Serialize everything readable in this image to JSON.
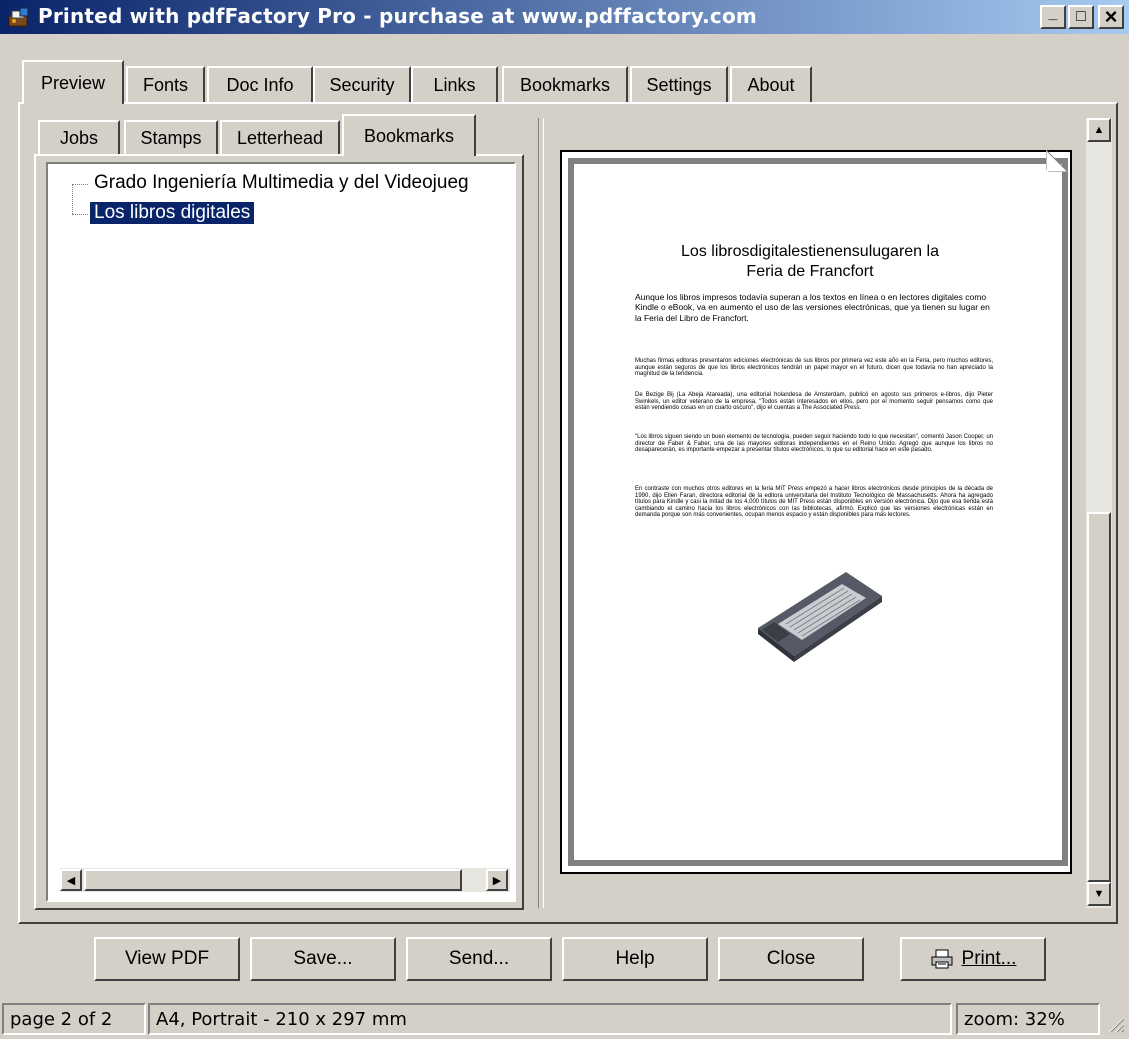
{
  "window": {
    "title": "Printed with pdfFactory Pro - purchase at www.pdffactory.com",
    "minimize": "_",
    "maximize": "□",
    "close": "×"
  },
  "tabs": [
    "Preview",
    "Fonts",
    "Doc Info",
    "Security",
    "Links",
    "Bookmarks",
    "Settings",
    "About"
  ],
  "subtabs": [
    "Jobs",
    "Stamps",
    "Letterhead",
    "Bookmarks"
  ],
  "bookmarks": [
    "Grado Ingeniería Multimedia y del Videojueg",
    "Los libros digitales"
  ],
  "document": {
    "title_line1": "Los librosdigitalestienensulugaren la",
    "title_line2": "Feria de Francfort",
    "lead": "Aunque los libros impresos todavía superan a los textos en línea o en lectores digitales como Kindle o eBook, va en aumento el uso de las versiones electrónicas, que ya tienen su lugar en la Feria del Libro de Francfort.",
    "para1": "Muchas firmas editoras presentaron ediciones electrónicas de sus libros por primera vez este año en la Feria, pero muchos editores, aunque están seguros de que los libros electrónicos tendrán un papel mayor en el futuro, dicen que todavía no han apreciado la magnitud de la tendencia.",
    "para2": "De Bezige Bij (La Abeja Atareada), una editorial holandesa de Amsterdam, publicó en agosto sus primeros e-libros, dijo Pieter Swinkels, un editor veterano de la empresa. \"Todos están interesados en ellos, pero por el momento seguir pensamos como que están vendiendo cosas en un cuarto oscuro\", dijo el cuentas a The Associated Press.",
    "para3": "\"Los libros siguen siendo un buen elemento de tecnología, pueden seguir haciendo todo lo que necesitan\", comentó Jason Cooper, un director de Faber & Faber, una de las mayores editoras independientes en el Reino Unido. Agregó que aunque los libros no desaparecerán, es importante empezar a presentar títulos electrónicos, lo que su editorial hace en este pasado.",
    "para4": "En contraste con muchos otros editores en la feria MIT Press empezó a hacer libros electrónicos desde principios de la década de 1990, dijo Ellen Faran, directora editorial de la editora universitaria del Instituto Tecnológico de Massachusetts. Ahora ha agregado títulos para Kindle y casi la mitad de los 4,000 títulos de MIT Press están disponibles en versión electrónica. Dijo que esa tienda está cambiando el camino hacia los libros electrónicos con las bibliotecas, afirmó. Explicó que las versiones electrónicas están en demanda porque son más convenientes, ocupan menos espacio y están disponibles para más lectores."
  },
  "buttons": {
    "view_pdf": "View PDF",
    "save": "Save...",
    "send": "Send...",
    "help": "Help",
    "close": "Close",
    "print": "Print..."
  },
  "status": {
    "page": "page 2 of 2",
    "paper": "A4, Portrait - 210 x 297 mm",
    "zoom": "zoom: 32%"
  }
}
